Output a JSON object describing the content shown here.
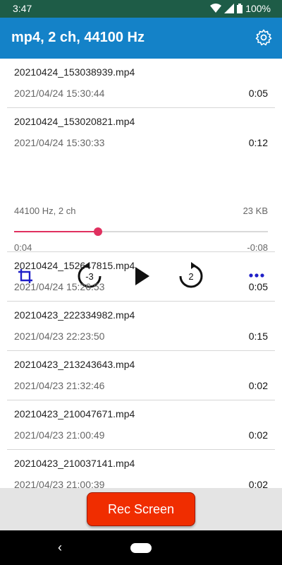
{
  "status": {
    "time": "3:47",
    "battery": "100%"
  },
  "app_bar": {
    "title": "mp4, 2 ch, 44100 Hz"
  },
  "recordings": [
    {
      "name": "20210424_153038939.mp4",
      "date": "2021/04/24 15:30:44",
      "duration": "0:05"
    },
    {
      "name": "20210424_153020821.mp4",
      "date": "2021/04/24 15:30:33",
      "duration": "0:12",
      "info": "44100 Hz, 2 ch",
      "size": "23 KB",
      "elapsed": "0:04",
      "remaining": "-0:08",
      "progress": 0.33
    },
    {
      "name": "20210424_152647815.mp4",
      "date": "2021/04/24 15:26:53",
      "duration": "0:05"
    },
    {
      "name": "20210423_222334982.mp4",
      "date": "2021/04/23 22:23:50",
      "duration": "0:15"
    },
    {
      "name": "20210423_213243643.mp4",
      "date": "2021/04/23 21:32:46",
      "duration": "0:02"
    },
    {
      "name": "20210423_210047671.mp4",
      "date": "2021/04/23 21:00:49",
      "duration": "0:02"
    },
    {
      "name": "20210423_210037141.mp4",
      "date": "2021/04/23 21:00:39",
      "duration": "0:02"
    }
  ],
  "player": {
    "rewind_label": "-3",
    "forward_label": "2"
  },
  "rec_button": {
    "label": "Rec Screen"
  },
  "icons": {
    "settings": "gear-icon",
    "crop": "crop-icon",
    "rewind": "replay-icon",
    "play": "play-icon",
    "forward": "forward-icon",
    "more": "more-icon"
  },
  "colors": {
    "app_bar": "#1482c8",
    "status_bar": "#1e5c47",
    "accent": "#e0305f",
    "rec_button": "#f02d00"
  }
}
